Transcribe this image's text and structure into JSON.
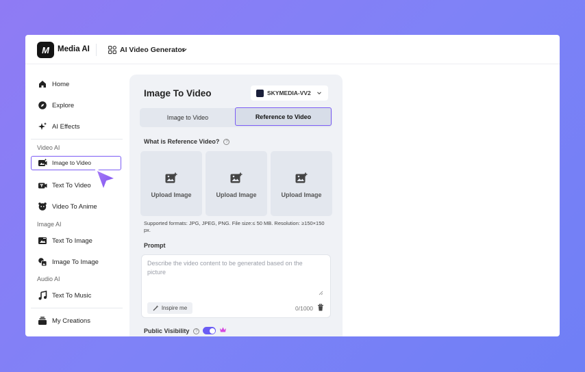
{
  "topbar": {
    "logo_text": "M",
    "brand": "Media AI",
    "generator_label": "AI Video Generator"
  },
  "sidebar": {
    "items": [
      {
        "label": "Home",
        "icon": "home-icon"
      },
      {
        "label": "Explore",
        "icon": "compass-icon"
      },
      {
        "label": "AI Effects",
        "icon": "sparkle-icon"
      }
    ],
    "sections": {
      "video": "Video AI",
      "image": "Image AI",
      "audio": "Audio AI"
    },
    "video_items": [
      {
        "label": "Image to Video",
        "icon": "image-video-icon",
        "active": true
      },
      {
        "label": "Text To Video",
        "icon": "text-video-icon"
      },
      {
        "label": "Video To Anime",
        "icon": "anime-icon"
      }
    ],
    "image_items": [
      {
        "label": "Text To Image",
        "icon": "text-image-icon"
      },
      {
        "label": "Image To Image",
        "icon": "image-image-icon"
      }
    ],
    "audio_items": [
      {
        "label": "Text To Music",
        "icon": "music-icon"
      }
    ],
    "creations": {
      "label": "My Creations",
      "icon": "stack-icon"
    }
  },
  "panel": {
    "title": "Image To Video",
    "model": "SKYMEDIA-VV2",
    "tabs": [
      "Image to Video",
      "Reference to Video"
    ],
    "active_tab": "Reference to Video",
    "question": "What is Reference Video?",
    "upload_boxes": [
      "Upload Image",
      "Upload Image",
      "Upload Image"
    ],
    "formats": "Supported formats: JPG, JPEG, PNG. File size:≤ 50 MB. Resolution: ≥150×150 px.",
    "prompt_label": "Prompt",
    "prompt_placeholder": "Describe the video content to be generated based on the picture",
    "inspire_label": "Inspire me",
    "counter": "0/1000",
    "visibility_label": "Public Visibility",
    "visibility_on": true
  },
  "colors": {
    "accent": "#7b5cf5",
    "toggle": "#6a5cf4",
    "crown": "#d64ae0"
  }
}
